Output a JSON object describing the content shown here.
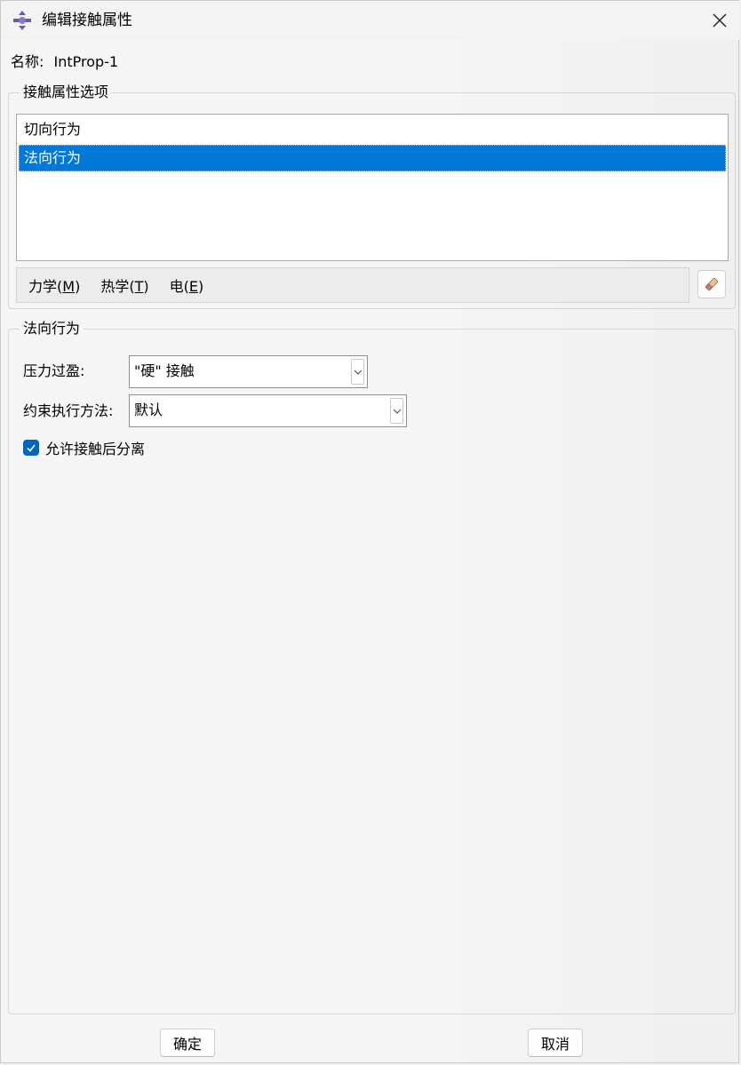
{
  "window": {
    "title": "编辑接触属性",
    "name_label": "名称:",
    "name_value": "IntProp-1"
  },
  "options_group": {
    "label": "接触属性选项",
    "items": [
      {
        "label": "切向行为",
        "selected": false
      },
      {
        "label": "法向行为",
        "selected": true
      }
    ]
  },
  "menubar": {
    "items": [
      {
        "label": "力学",
        "mnemonic": "M"
      },
      {
        "label": "热学",
        "mnemonic": "T"
      },
      {
        "label": "电",
        "mnemonic": "E"
      }
    ],
    "eraser_icon": "eraser-icon"
  },
  "behavior_group": {
    "label": "法向行为",
    "pressure_label": "压力过盈:",
    "pressure_value": "\"硬\" 接触",
    "constraint_label": "约束执行方法:",
    "constraint_value": "默认",
    "allow_separation_label": "允许接触后分离",
    "allow_separation_checked": true
  },
  "footer": {
    "ok_label": "确定",
    "cancel_label": "取消"
  },
  "colors": {
    "selection": "#0078d7",
    "checkbox": "#0067c0"
  }
}
